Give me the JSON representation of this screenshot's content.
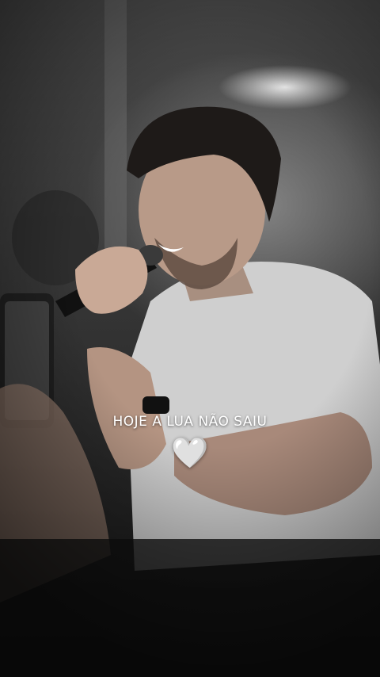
{
  "caption": {
    "text": "HOJE A LUA NÃO SAIU",
    "emoji": "🤍"
  },
  "colors": {
    "caption_text": "#ffffff",
    "background_dark": "#1b1b1b"
  }
}
